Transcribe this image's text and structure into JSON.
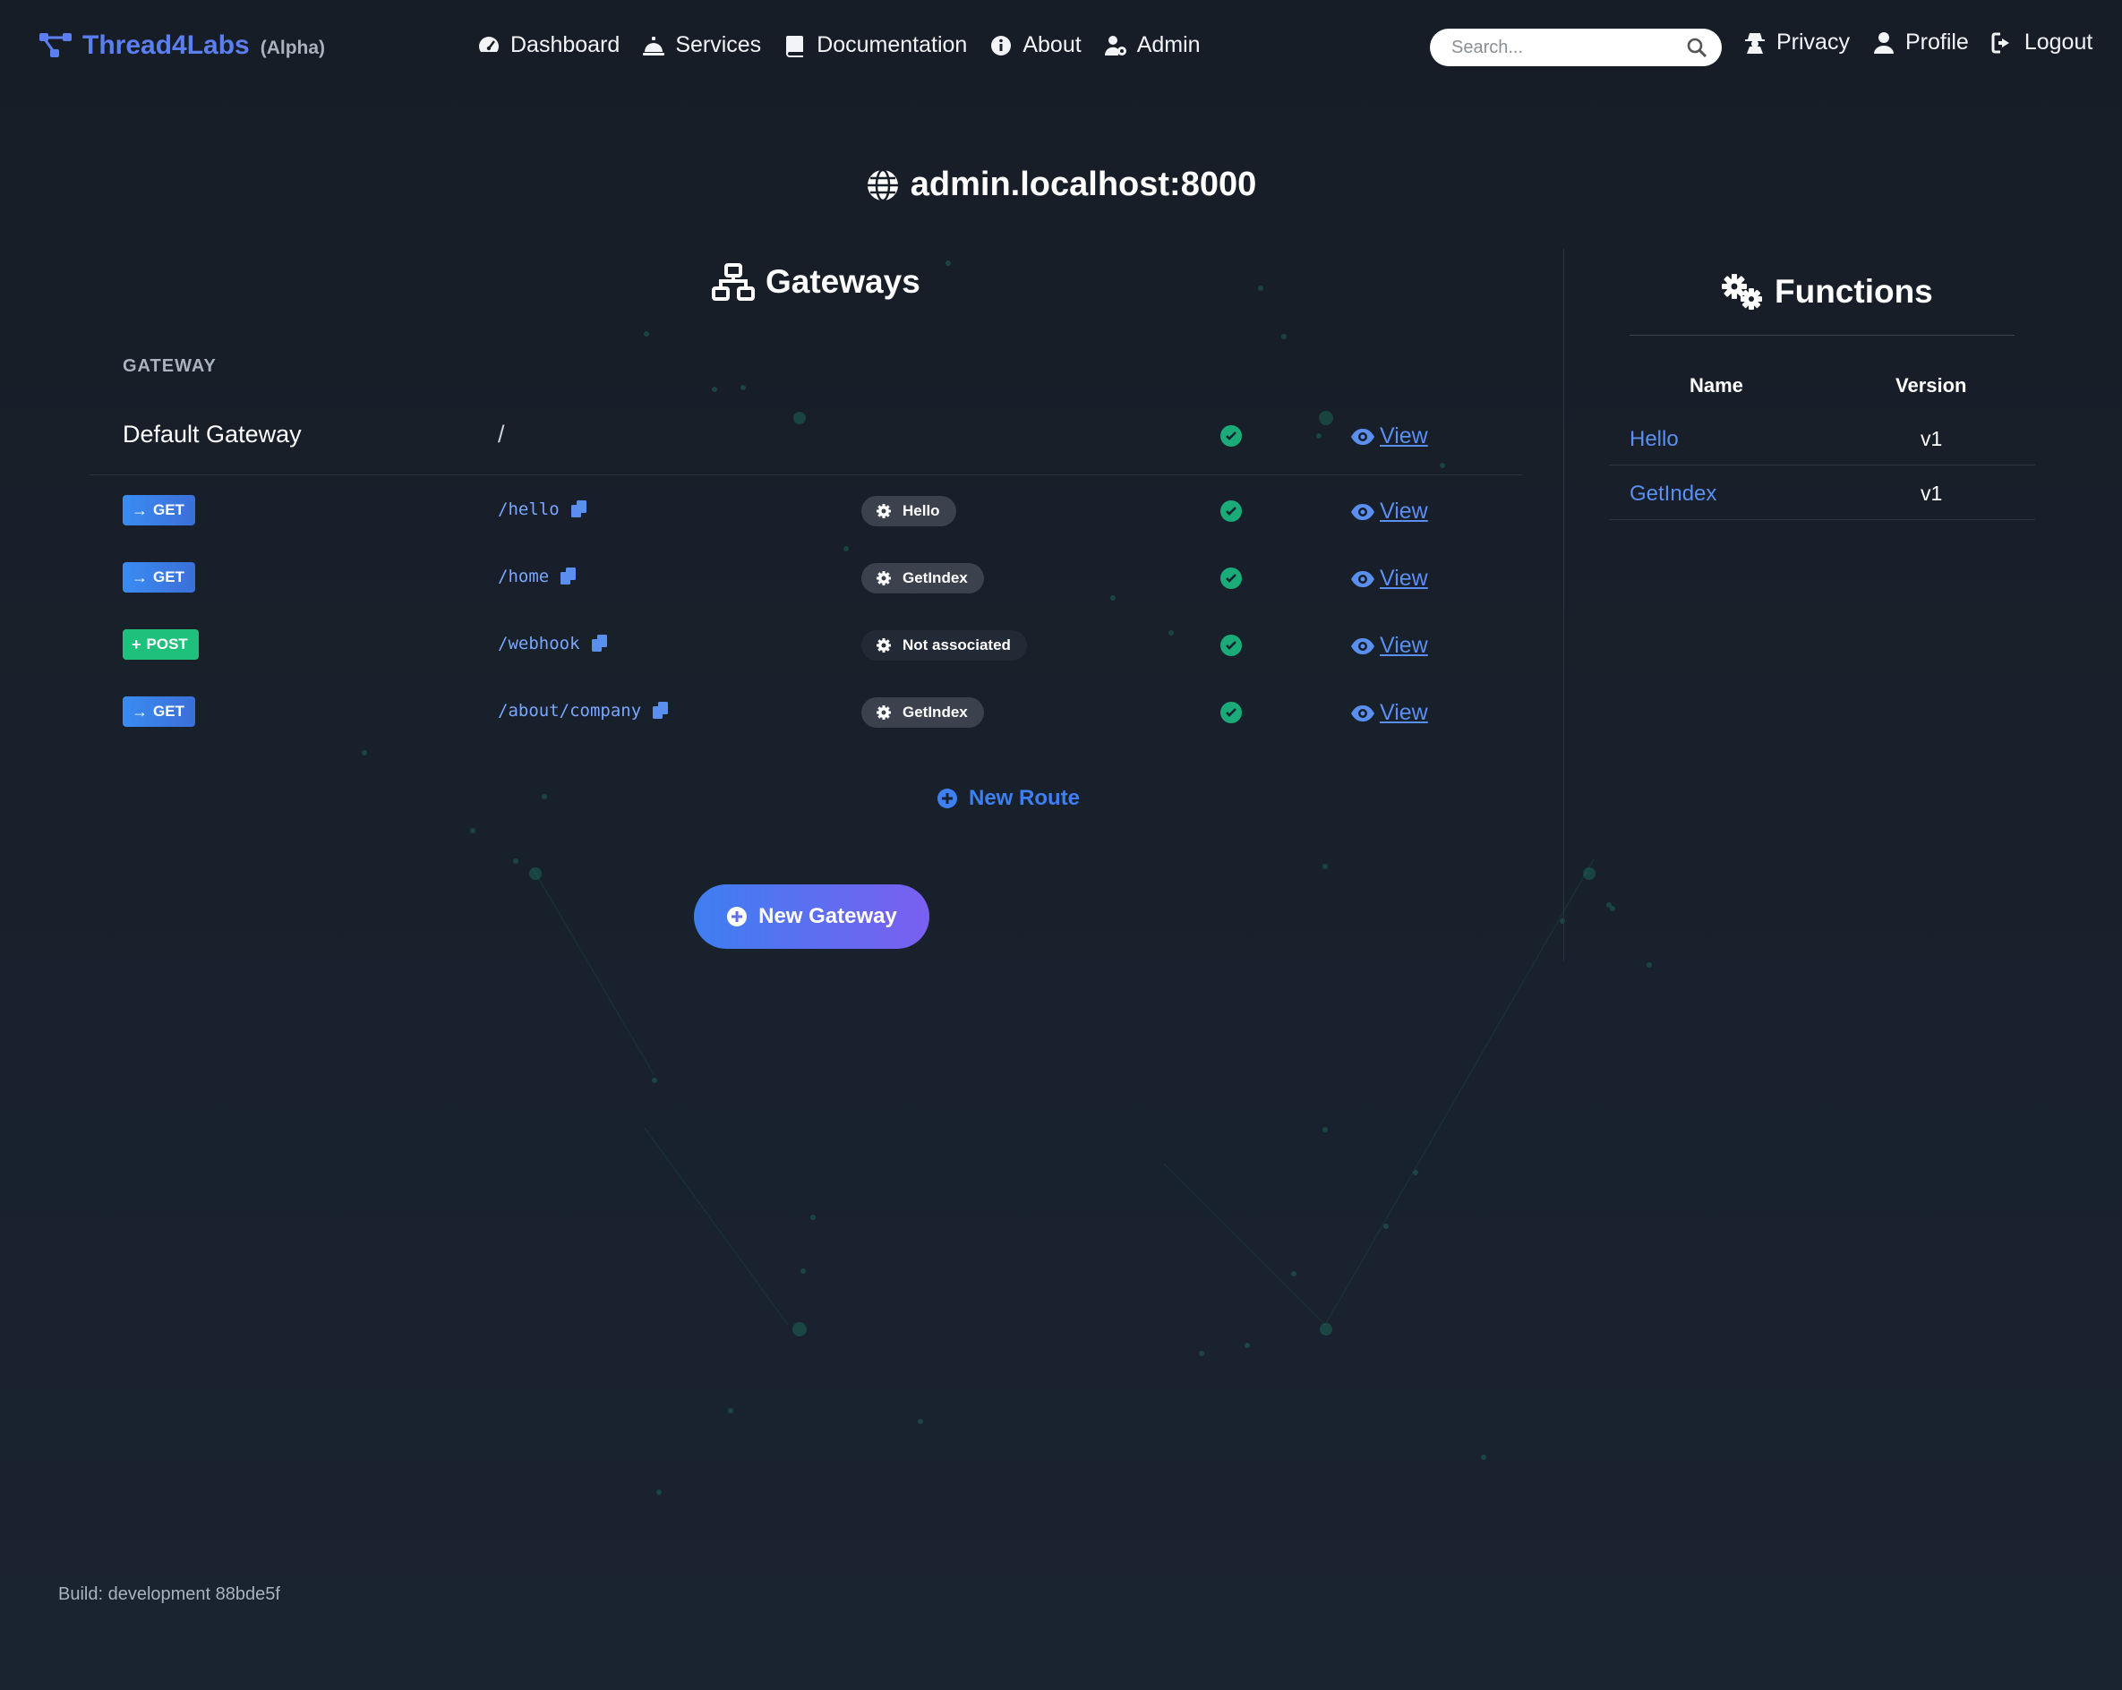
{
  "navbar": {
    "brand": "Thread4Labs",
    "brand_tag": "(Alpha)",
    "links": [
      {
        "label": "Dashboard",
        "icon": "gauge-icon"
      },
      {
        "label": "Services",
        "icon": "bell-icon"
      },
      {
        "label": "Documentation",
        "icon": "book-icon"
      },
      {
        "label": "About",
        "icon": "info-icon"
      },
      {
        "label": "Admin",
        "icon": "user-gear-icon"
      }
    ],
    "search_placeholder": "Search...",
    "right_links": [
      {
        "label": "Privacy",
        "icon": "user-secret-icon"
      },
      {
        "label": "Profile",
        "icon": "user-icon"
      },
      {
        "label": "Logout",
        "icon": "logout-icon"
      }
    ]
  },
  "host": "admin.localhost:8000",
  "gateways": {
    "title": "Gateways",
    "column_header": "GATEWAY",
    "gateway": {
      "name": "Default Gateway",
      "path": "/",
      "view_label": "View"
    },
    "routes": [
      {
        "method": "GET",
        "path": "/hello",
        "function": "Hello",
        "view_label": "View"
      },
      {
        "method": "GET",
        "path": "/home",
        "function": "GetIndex",
        "view_label": "View"
      },
      {
        "method": "POST",
        "path": "/webhook",
        "function": "Not associated",
        "view_label": "View"
      },
      {
        "method": "GET",
        "path": "/about/company",
        "function": "GetIndex",
        "view_label": "View"
      }
    ],
    "new_route_label": "New Route",
    "new_gateway_label": "New Gateway"
  },
  "functions": {
    "title": "Functions",
    "headers": {
      "name": "Name",
      "version": "Version"
    },
    "rows": [
      {
        "name": "Hello",
        "version": "v1"
      },
      {
        "name": "GetIndex",
        "version": "v1"
      }
    ]
  },
  "footer": {
    "build": "Build: development 88bde5f"
  },
  "colors": {
    "accent": "#3e7ff2",
    "success": "#1aab78",
    "get": "#3b82f6",
    "post": "#1fbf7c",
    "background": "#18212d"
  }
}
